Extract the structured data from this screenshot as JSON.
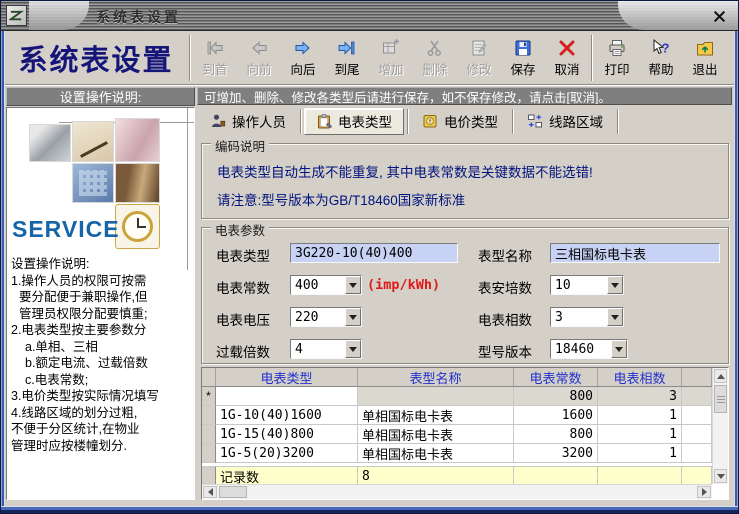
{
  "window": {
    "title": "系统表设置"
  },
  "toolbar": {
    "app_title": "系统表设置",
    "buttons": [
      {
        "label": "到首",
        "disabled": true
      },
      {
        "label": "向前",
        "disabled": true
      },
      {
        "label": "向后",
        "disabled": false
      },
      {
        "label": "到尾",
        "disabled": false
      },
      {
        "label": "增加",
        "disabled": true
      },
      {
        "label": "删除",
        "disabled": true
      },
      {
        "label": "修改",
        "disabled": true
      },
      {
        "label": "保存",
        "disabled": false
      },
      {
        "label": "取消",
        "disabled": false
      },
      {
        "label": "打印",
        "disabled": false
      },
      {
        "label": "帮助",
        "disabled": false
      },
      {
        "label": "退出",
        "disabled": false
      }
    ]
  },
  "sidebar": {
    "header": "设置操作说明:",
    "service_text": "SERVICE",
    "instructions": [
      "设置操作说明:",
      "1.操作人员的权限可按需",
      "要分配便于兼职操作,但",
      "管理员权限分配要慎重;",
      "2.电表类型按主要参数分",
      "a.单相、三相",
      "b.额定电流、过载倍数",
      "c.电表常数;",
      "3.电价类型按实际情况填写",
      "4.线路区域的划分过粗,",
      "不便于分区统计,在物业",
      "管理时应按楼幢划分."
    ]
  },
  "main": {
    "notice": "可增加、删除、修改各类型后请进行保存，如不保存修改，请点击[取消]。",
    "tabs": [
      {
        "label": "操作人员",
        "active": false
      },
      {
        "label": "电表类型",
        "active": true
      },
      {
        "label": "电价类型",
        "active": false
      },
      {
        "label": "线路区域",
        "active": false
      }
    ],
    "encoding_box": {
      "title": "编码说明",
      "line1": "电表类型自动生成不能重复, 其中电表常数是关键数据不能选错!",
      "line2": "请注意:型号版本为GB/T18460国家新标准"
    },
    "params_box": {
      "title": "电表参数",
      "fields": {
        "meter_type": {
          "label": "电表类型",
          "value": "3G220-10(40)400"
        },
        "model_name": {
          "label": "表型名称",
          "value": "三相国标电卡表"
        },
        "meter_constant": {
          "label": "电表常数",
          "value": "400",
          "unit": "(imp/kWh)"
        },
        "ampere": {
          "label": "表安培数",
          "value": "10"
        },
        "voltage": {
          "label": "电表电压",
          "value": "220"
        },
        "phases": {
          "label": "电表相数",
          "value": "3"
        },
        "overload": {
          "label": "过载倍数",
          "value": "4"
        },
        "version": {
          "label": "型号版本",
          "value": "18460"
        }
      }
    },
    "table": {
      "headers": [
        "电表类型",
        "表型名称",
        "电表常数",
        "电表相数"
      ],
      "new_row": {
        "selector": "*",
        "values": [
          "",
          "",
          "800",
          "3"
        ]
      },
      "rows": [
        [
          "1G-10(40)1600",
          "单相国标电卡表",
          "1600",
          "1"
        ],
        [
          "1G-15(40)800",
          "单相国标电卡表",
          "800",
          "1"
        ],
        [
          "1G-5(20)3200",
          "单相国标电卡表",
          "3200",
          "1"
        ]
      ],
      "footer": {
        "label": "记录数",
        "value": "8"
      }
    }
  },
  "colors": {
    "window_bg": "#d4d0c8",
    "frame_blue": "#3a5cae",
    "app_title_navy": "#15157a",
    "notice_bg": "#7f7f7f",
    "input_lavender": "#c7d2f4",
    "unit_red": "#e01818",
    "encoding_text_navy": "#00127d",
    "table_header_text": "#2230cc",
    "footer_row_yellow": "#ffffcc",
    "service_blue": "#1565a8"
  }
}
